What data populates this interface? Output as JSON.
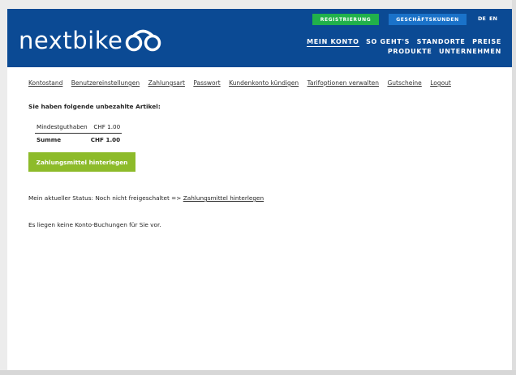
{
  "header": {
    "logo_text": "nextbike",
    "register_label": "REGISTRIERUNG",
    "business_label": "GESCHÄFTSKUNDEN",
    "lang_de": "DE",
    "lang_en": "EN",
    "main_nav": [
      "MEIN KONTO",
      "SO GEHT'S",
      "STANDORTE",
      "PREISE",
      "PRODUKTE",
      "UNTERNEHMEN"
    ]
  },
  "subnav": [
    "Kontostand",
    "Benutzereinstellungen",
    "Zahlungsart",
    "Passwort",
    "Kundenkonto kündigen",
    "Tarifoptionen verwalten",
    "Gutscheine",
    "Logout"
  ],
  "content": {
    "unpaid_heading": "Sie haben folgende unbezahlte Artikel:",
    "items": [
      {
        "label": "Mindestguthaben",
        "amount": "CHF 1.00"
      }
    ],
    "sum_label": "Summe",
    "sum_amount": "CHF 1.00",
    "pay_button": "Zahlungsmittel hinterlegen",
    "status_prefix": "Mein aktueller Status: Noch nicht freigeschaltet =>",
    "status_link": "Zahlungsmittel hinterlegen",
    "no_bookings": "Es liegen keine Konto-Buchungen für Sie vor."
  },
  "colors": {
    "header_bg": "#0b4a94",
    "register_bg": "#21b14b",
    "business_bg": "#1a72c9",
    "pay_button_bg": "#8dbb2a"
  },
  "icons": {
    "logo": "bike-logo-icon"
  }
}
